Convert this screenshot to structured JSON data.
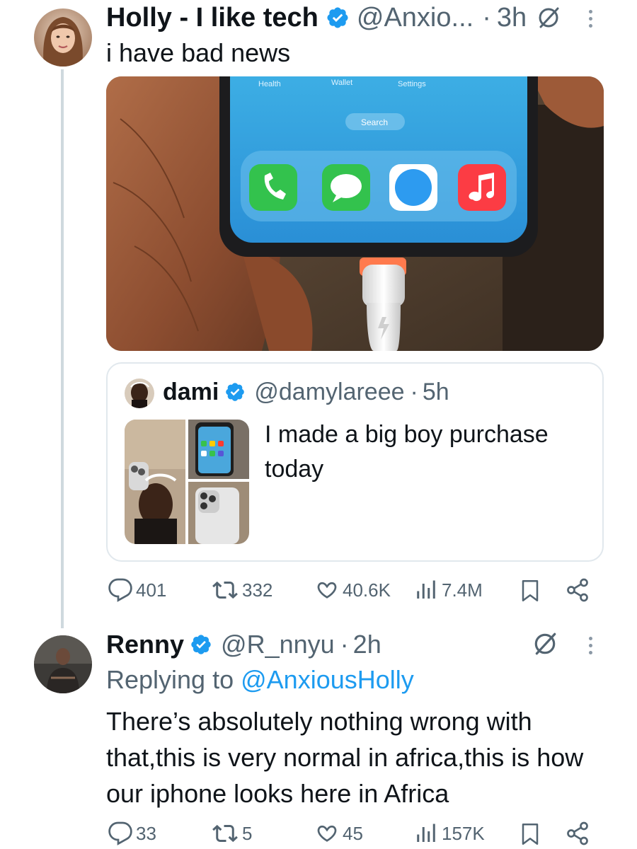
{
  "tweet": {
    "display_name": "Holly - I like tech",
    "handle": "@Anxio...",
    "separator": "·",
    "time": "3h",
    "text": "i have bad news",
    "media_overlay_labels": {
      "health": "Health",
      "wallet": "Wallet",
      "settings": "Settings",
      "search": "Search"
    },
    "actions": {
      "replies": "401",
      "retweets": "332",
      "likes": "40.6K",
      "views": "7.4M"
    }
  },
  "quote": {
    "display_name": "dami",
    "handle": "@damylareee",
    "separator": "·",
    "time": "5h",
    "text": "I made a big boy purchase today"
  },
  "reply": {
    "display_name": "Renny",
    "handle": "@R_nnyu",
    "separator": "·",
    "time": "2h",
    "replying_label": "Replying to",
    "replying_to": "@AnxiousHolly",
    "text": "There’s absolutely nothing wrong with that,this is very normal in africa,this is how our iphone looks here in Africa",
    "actions": {
      "replies": "33",
      "retweets": "5",
      "likes": "45",
      "views": "157K"
    }
  },
  "colors": {
    "verified": "#1d9bf0",
    "link": "#1d9bf0",
    "muted": "#536471",
    "border": "#e1e8ed"
  },
  "icons": {
    "verified": "verified-badge-icon",
    "grok": "grok-icon",
    "more": "more-dots-icon",
    "reply": "reply-icon",
    "retweet": "retweet-icon",
    "like": "heart-icon",
    "views": "views-icon",
    "bookmark": "bookmark-icon",
    "share": "share-icon"
  }
}
